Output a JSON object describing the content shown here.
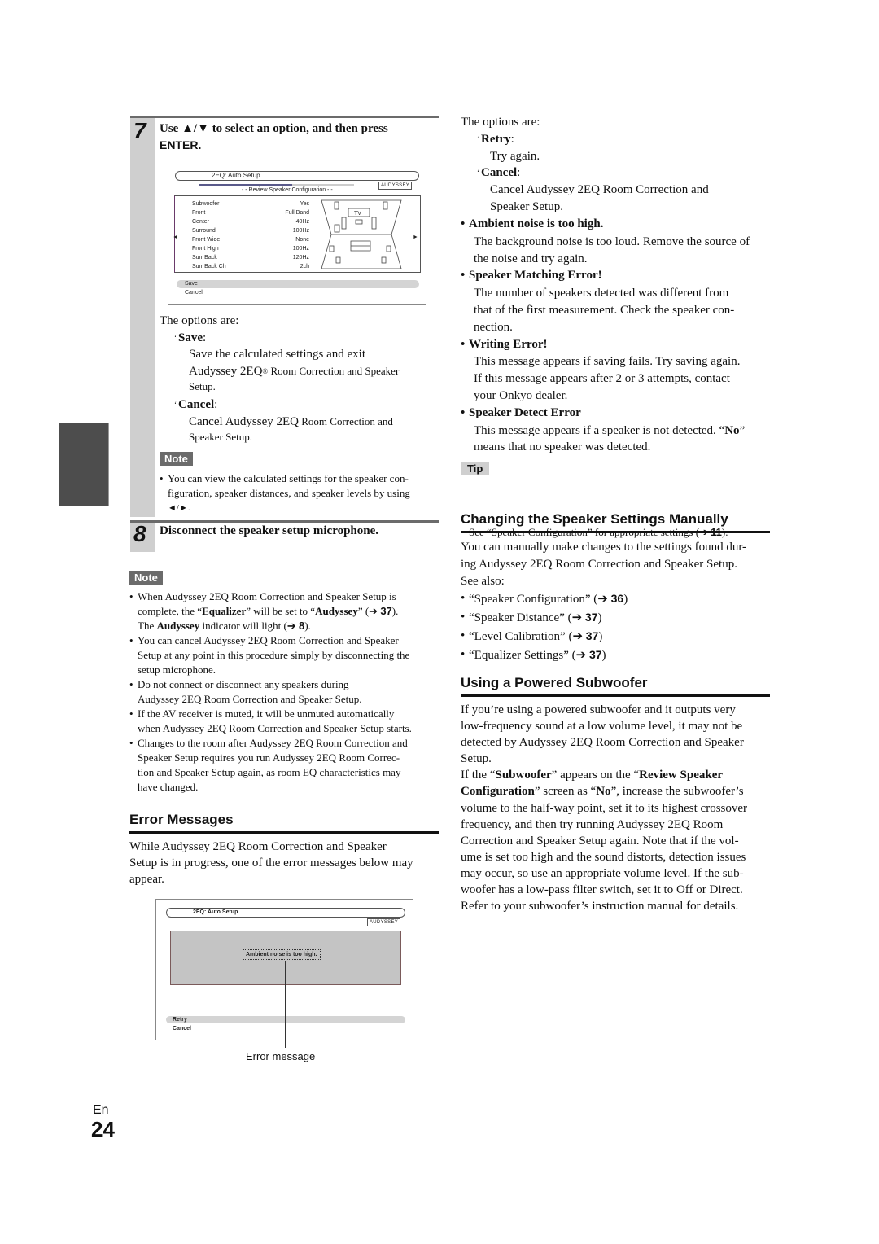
{
  "side_tab": {
    "color": "#4d4d4d"
  },
  "step7": {
    "number": "7",
    "title_part1": "Use ▲/▼ to select an option, and then press",
    "title_part2": "ENTER."
  },
  "osd1": {
    "title": "2EQ: Auto Setup",
    "subtitle": "- -  Review Speaker Configuration  - -",
    "brand": "AUDYSSEY",
    "rows": [
      {
        "label": "Subwoofer",
        "value": "Yes"
      },
      {
        "label": "Front",
        "value": "Full Band"
      },
      {
        "label": "Center",
        "value": "40Hz"
      },
      {
        "label": "Surround",
        "value": "100Hz"
      },
      {
        "label": "Front Wide",
        "value": "None"
      },
      {
        "label": "Front High",
        "value": "100Hz"
      },
      {
        "label": "Surr Back",
        "value": "120Hz"
      },
      {
        "label": "Surr Back Ch",
        "value": "2ch"
      }
    ],
    "tv_label": "TV",
    "menu": [
      "Save",
      "Cancel"
    ]
  },
  "step7_options": {
    "intro": "The options are:",
    "items": [
      {
        "label": "Save",
        "desc1": "Save the calculated settings and exit",
        "desc2a": "Audyssey 2EQ",
        "desc2b": "®",
        "desc2c": " Room Correction and Speaker",
        "desc3": "Setup."
      },
      {
        "label": "Cancel",
        "desc1a": "Cancel Audyssey 2EQ",
        "desc1b": " Room Correction and",
        "desc2": "Speaker Setup."
      }
    ]
  },
  "note1": {
    "tag": "Note",
    "text_a": "You can view the calculated settings for the speaker con-",
    "text_b": "figuration, speaker distances, and speaker levels by using",
    "text_c": "◄/►."
  },
  "step8": {
    "number": "8",
    "title": "Disconnect the speaker setup microphone."
  },
  "note2": {
    "tag": "Note",
    "items": [
      {
        "l1a": "When Audyssey 2EQ Room Correction and Speaker Setup is",
        "l2a": "complete, the “",
        "l2b": "Equalizer",
        "l2c": "” will be set to “",
        "l2d": "Audyssey",
        "l2e": "” (➔ ",
        "l2f": "37",
        "l2g": ").",
        "l3a": "The ",
        "l3b": "Audyssey",
        "l3c": " indicator will light (➔ ",
        "l3d": "8",
        "l3e": ")."
      },
      {
        "lines": [
          "You can cancel Audyssey 2EQ Room Correction and Speaker",
          "Setup at any point in this procedure simply by disconnecting the",
          "setup microphone."
        ]
      },
      {
        "lines": [
          "Do not connect or disconnect any speakers during",
          "Audyssey 2EQ Room Correction and Speaker Setup."
        ]
      },
      {
        "lines": [
          "If the AV receiver is muted, it will be unmuted automatically",
          "when Audyssey 2EQ Room Correction and Speaker Setup starts."
        ]
      },
      {
        "lines": [
          "Changes to the room after Audyssey 2EQ Room Correction and",
          "Speaker Setup requires you run Audyssey 2EQ Room Correc-",
          "tion and Speaker Setup again, as room EQ characteristics may",
          "have changed."
        ]
      }
    ]
  },
  "error_messages": {
    "heading": "Error Messages",
    "intro": [
      "While Audyssey 2EQ Room Correction and Speaker",
      "Setup is in progress, one of the error messages below may",
      "appear."
    ],
    "osd": {
      "title": "2EQ: Auto Setup",
      "brand": "AUDYSSEY",
      "message": "Ambient noise is too high.",
      "menu": [
        "Retry",
        "Cancel"
      ],
      "callout": "Error message"
    }
  },
  "right": {
    "options_intro": "The options are:",
    "options": [
      {
        "label": "Retry",
        "desc": [
          "Try again."
        ]
      },
      {
        "label": "Cancel",
        "desc": [
          "Cancel Audyssey 2EQ Room Correction and",
          "Speaker Setup."
        ]
      }
    ],
    "errors": [
      {
        "title": "Ambient noise is too high.",
        "lines": [
          "The background noise is too loud. Remove the source of",
          "the noise and try again."
        ]
      },
      {
        "title": "Speaker Matching Error!",
        "lines": [
          "The number of speakers detected was different from",
          "that of the first measurement. Check the speaker con-",
          "nection."
        ]
      },
      {
        "title": "Writing Error!",
        "lines": [
          "This message appears if saving fails. Try saving again.",
          "If this message appears after 2 or 3 attempts, contact",
          "your Onkyo dealer."
        ]
      },
      {
        "title": "Speaker Detect Error",
        "l1a": "This message appears if a speaker is not detected. “",
        "l1b": "No",
        "l1c": "”",
        "l2": "means that no speaker was detected."
      }
    ],
    "tip": {
      "tag": "Tip",
      "text_a": "See “Speaker Configuration” for appropriate settings (➔ ",
      "ref": "11",
      "text_b": ")."
    }
  },
  "manual": {
    "heading": "Changing the Speaker Settings Manually",
    "intro": [
      "You can manually make changes to the settings found dur-",
      "ing Audyssey 2EQ Room Correction and Speaker Setup.",
      "See also:"
    ],
    "refs": [
      {
        "label": "“Speaker Configuration” (➔ ",
        "page": "36"
      },
      {
        "label": "“Speaker Distance” (➔ ",
        "page": "37"
      },
      {
        "label": "“Level Calibration” (➔ ",
        "page": "37"
      },
      {
        "label": "“Equalizer Settings” (➔ ",
        "page": "37"
      }
    ]
  },
  "subwoofer": {
    "heading": "Using a Powered Subwoofer",
    "para1": [
      "If you’re using a powered subwoofer and it outputs very",
      "low-frequency sound at a low volume level, it may not be",
      "detected by Audyssey 2EQ Room Correction and Speaker",
      "Setup."
    ],
    "p2_l1a": "If the “",
    "p2_l1b": "Subwoofer",
    "p2_l1c": "” appears on the “",
    "p2_l1d": "Review Speaker",
    "p2_l2a": "Configuration",
    "p2_l2b": "” screen as “",
    "p2_l2c": "No",
    "p2_l2d": "”, increase the subwoofer’s",
    "para2_rest": [
      "volume to the half-way point, set it to its highest crossover",
      "frequency, and then try running Audyssey 2EQ Room",
      "Correction and Speaker Setup again. Note that if the vol-",
      "ume is set too high and the sound distorts, detection issues",
      "may occur, so use an appropriate volume level. If the sub-",
      "woofer has a low-pass filter switch, set it to Off or Direct.",
      "Refer to your subwoofer’s instruction manual for details."
    ]
  },
  "footer": {
    "lang": "En",
    "page": "24"
  }
}
